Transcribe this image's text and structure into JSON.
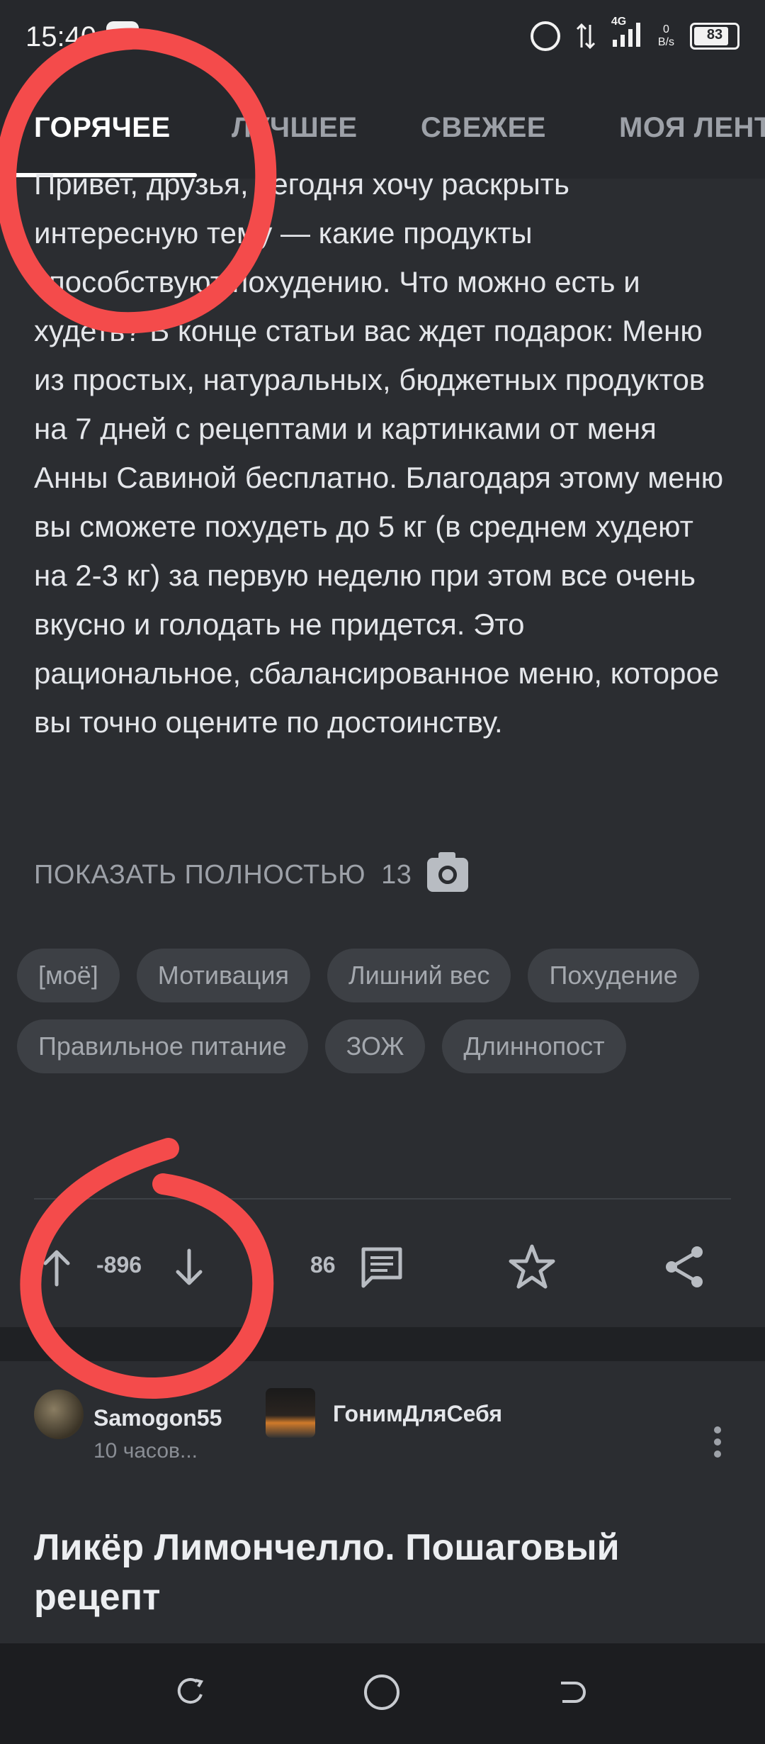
{
  "status_bar": {
    "time": "15:40",
    "network": "4G",
    "net_speed_value": "0",
    "net_speed_unit": "B/s",
    "battery": "83",
    "battery_level": 0.83
  },
  "tabs": [
    {
      "label": "ГОРЯЧЕЕ",
      "active": true
    },
    {
      "label": "ЛУЧШЕЕ",
      "active": false
    },
    {
      "label": "СВЕЖЕЕ",
      "active": false
    },
    {
      "label": "МОЯ ЛЕНТА",
      "active": false
    }
  ],
  "post": {
    "text": "Привет, друзья, сегодня хочу раскрыть интересную тему — какие продукты способствуют похудению. Что можно есть и худеть? В конце статьи вас ждет подарок: Меню из простых, натуральных, бюджетных продуктов на 7 дней с рецептами и картинками от меня Анны Савиной бесплатно. Благодаря этому меню вы сможете похудеть до 5 кг (в среднем худеют на 2-3 кг) за первую неделю при этом все очень вкусно и голодать не придется. Это рациональное, сбалансированное меню, которое вы точно оцените по достоинству.",
    "show_full_label": "ПОКАЗАТЬ ПОЛНОСТЬЮ",
    "image_count": "13",
    "tags": [
      "[моё]",
      "Мотивация",
      "Лишний вес",
      "Похудение",
      "Правильное питание",
      "ЗОЖ",
      "Длиннопост"
    ],
    "rating": "-896",
    "comments_count": "86"
  },
  "next_post": {
    "author": "Samogon55",
    "time_ago": "10 часов...",
    "community": "ГонимДляСебя",
    "title": "Ликёр Лимончелло. Пошаговый рецепт"
  },
  "colors": {
    "background": "#2b2d31",
    "annotation": "#f44b4b",
    "text": "#e4e6ea",
    "muted": "#9da1a8"
  }
}
